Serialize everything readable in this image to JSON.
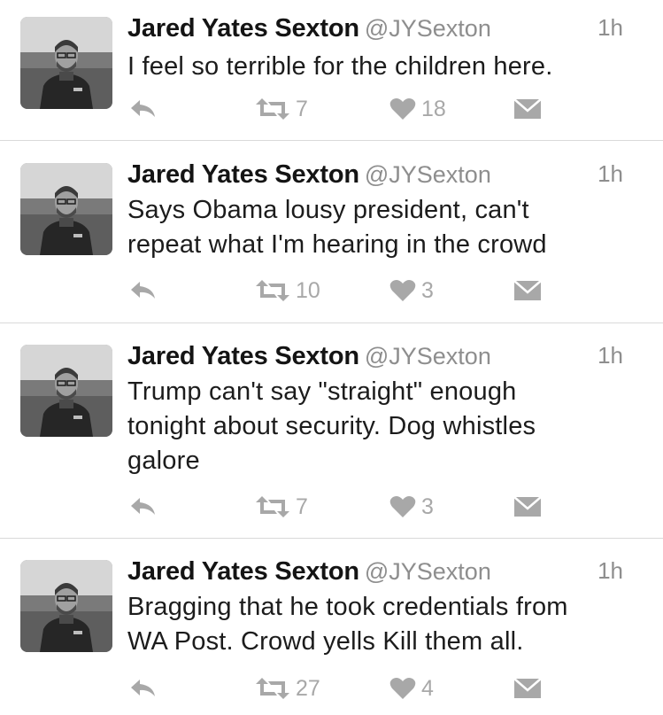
{
  "tweets": [
    {
      "name": "Jared Yates Sexton",
      "handle": "@JYSexton",
      "time": "1h",
      "lines": [
        "I feel so terrible for the children here."
      ],
      "retweets": "7",
      "likes": "18"
    },
    {
      "name": "Jared Yates Sexton",
      "handle": "@JYSexton",
      "time": "1h",
      "lines": [
        "Says Obama lousy president, can't",
        "repeat what I'm hearing in the crowd"
      ],
      "retweets": "10",
      "likes": "3"
    },
    {
      "name": "Jared Yates Sexton",
      "handle": "@JYSexton",
      "time": "1h",
      "lines": [
        "Trump can't say \"straight\" enough",
        "tonight about security. Dog whistles",
        "galore"
      ],
      "retweets": "7",
      "likes": "3"
    },
    {
      "name": "Jared Yates Sexton",
      "handle": "@JYSexton",
      "time": "1h",
      "lines": [
        "Bragging that he took credentials from",
        "WA Post. Crowd yells Kill them all."
      ],
      "retweets": "27",
      "likes": "4"
    }
  ],
  "icons": {
    "reply": "reply-icon",
    "retweet": "retweet-icon",
    "like": "heart-icon",
    "dm": "envelope-icon"
  },
  "colors": {
    "icon_gray": "#a8a8a8",
    "handle_gray": "#8e8e8e",
    "divider": "#d9d9d9"
  }
}
